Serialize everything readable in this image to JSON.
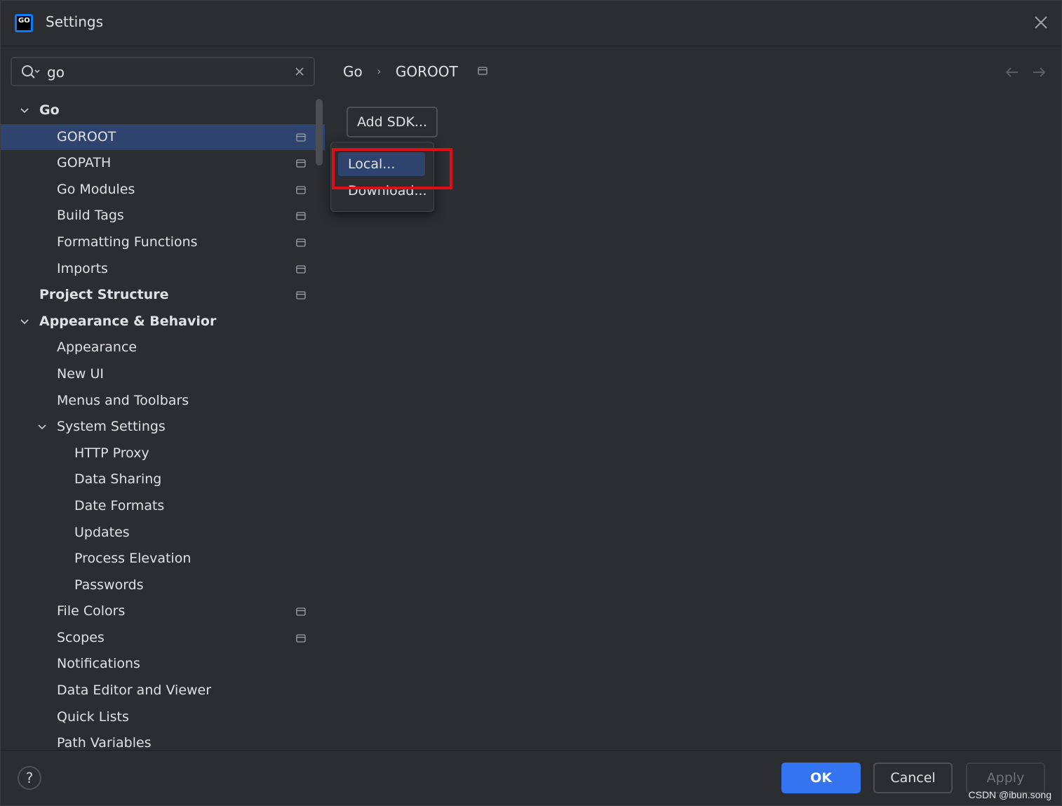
{
  "window": {
    "title": "Settings",
    "logo_text": "GO"
  },
  "search": {
    "value": "go"
  },
  "tree": [
    {
      "label": "Go",
      "level": 0,
      "bold": true,
      "expanded": true,
      "project_icon": false,
      "selected": false
    },
    {
      "label": "GOROOT",
      "level": 1,
      "bold": false,
      "expanded": null,
      "project_icon": true,
      "selected": true
    },
    {
      "label": "GOPATH",
      "level": 1,
      "bold": false,
      "expanded": null,
      "project_icon": true,
      "selected": false
    },
    {
      "label": "Go Modules",
      "level": 1,
      "bold": false,
      "expanded": null,
      "project_icon": true,
      "selected": false
    },
    {
      "label": "Build Tags",
      "level": 1,
      "bold": false,
      "expanded": null,
      "project_icon": true,
      "selected": false
    },
    {
      "label": "Formatting Functions",
      "level": 1,
      "bold": false,
      "expanded": null,
      "project_icon": true,
      "selected": false
    },
    {
      "label": "Imports",
      "level": 1,
      "bold": false,
      "expanded": null,
      "project_icon": true,
      "selected": false
    },
    {
      "label": "Project Structure",
      "level": 0,
      "bold": true,
      "expanded": null,
      "project_icon": true,
      "selected": false
    },
    {
      "label": "Appearance & Behavior",
      "level": 0,
      "bold": true,
      "expanded": true,
      "project_icon": false,
      "selected": false
    },
    {
      "label": "Appearance",
      "level": 1,
      "bold": false,
      "expanded": null,
      "project_icon": false,
      "selected": false
    },
    {
      "label": "New UI",
      "level": 1,
      "bold": false,
      "expanded": null,
      "project_icon": false,
      "selected": false
    },
    {
      "label": "Menus and Toolbars",
      "level": 1,
      "bold": false,
      "expanded": null,
      "project_icon": false,
      "selected": false
    },
    {
      "label": "System Settings",
      "level": 1,
      "bold": false,
      "expanded": true,
      "project_icon": false,
      "selected": false
    },
    {
      "label": "HTTP Proxy",
      "level": 2,
      "bold": false,
      "expanded": null,
      "project_icon": false,
      "selected": false
    },
    {
      "label": "Data Sharing",
      "level": 2,
      "bold": false,
      "expanded": null,
      "project_icon": false,
      "selected": false
    },
    {
      "label": "Date Formats",
      "level": 2,
      "bold": false,
      "expanded": null,
      "project_icon": false,
      "selected": false
    },
    {
      "label": "Updates",
      "level": 2,
      "bold": false,
      "expanded": null,
      "project_icon": false,
      "selected": false
    },
    {
      "label": "Process Elevation",
      "level": 2,
      "bold": false,
      "expanded": null,
      "project_icon": false,
      "selected": false
    },
    {
      "label": "Passwords",
      "level": 2,
      "bold": false,
      "expanded": null,
      "project_icon": false,
      "selected": false
    },
    {
      "label": "File Colors",
      "level": 1,
      "bold": false,
      "expanded": null,
      "project_icon": true,
      "selected": false
    },
    {
      "label": "Scopes",
      "level": 1,
      "bold": false,
      "expanded": null,
      "project_icon": true,
      "selected": false
    },
    {
      "label": "Notifications",
      "level": 1,
      "bold": false,
      "expanded": null,
      "project_icon": false,
      "selected": false
    },
    {
      "label": "Data Editor and Viewer",
      "level": 1,
      "bold": false,
      "expanded": null,
      "project_icon": false,
      "selected": false
    },
    {
      "label": "Quick Lists",
      "level": 1,
      "bold": false,
      "expanded": null,
      "project_icon": false,
      "selected": false
    },
    {
      "label": "Path Variables",
      "level": 1,
      "bold": false,
      "expanded": null,
      "project_icon": false,
      "selected": false
    }
  ],
  "breadcrumb": {
    "parent": "Go",
    "current": "GOROOT"
  },
  "content": {
    "add_sdk_label": "Add SDK...",
    "popup_items": [
      "Local...",
      "Download..."
    ]
  },
  "footer": {
    "help_label": "?",
    "ok_label": "OK",
    "cancel_label": "Cancel",
    "apply_label": "Apply",
    "watermark": "CSDN @ibun.song"
  },
  "colors": {
    "background": "#2b2d30",
    "selection": "#2e436e",
    "accent": "#3574f0",
    "highlight": "#e00d16"
  },
  "icons": {
    "search": "search-icon",
    "clear": "close-icon",
    "window_close": "close-icon",
    "chevron": "chevron-down-icon",
    "project": "project-scope-icon",
    "back": "arrow-left-icon",
    "forward": "arrow-right-icon"
  }
}
